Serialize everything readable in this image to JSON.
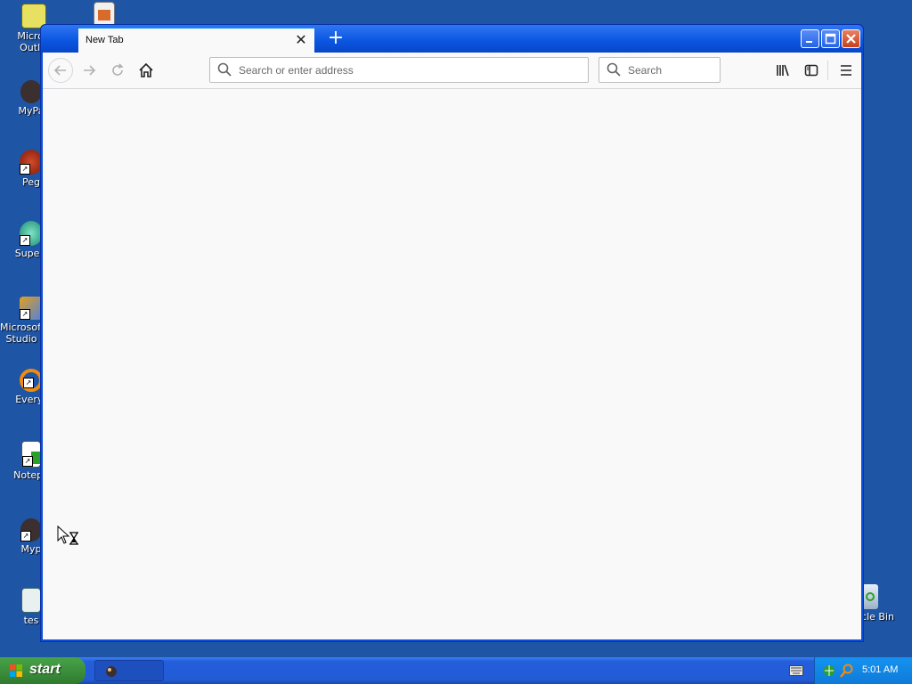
{
  "desktop": {
    "icons": [
      {
        "label": "Micros Outlo",
        "icon": "outlook-icon"
      },
      {
        "label": "MyPa",
        "icon": "people-icon"
      },
      {
        "label": "Peg",
        "icon": "app-icon"
      },
      {
        "label": "Superr",
        "icon": "globe-icon"
      },
      {
        "label": "Microsoft Studio",
        "icon": "studio-icon"
      },
      {
        "label": "Everyt",
        "icon": "search-app-icon"
      },
      {
        "label": "Notepa",
        "icon": "notepad-icon"
      },
      {
        "label": "Myp",
        "icon": "people-icon"
      },
      {
        "label": "tes",
        "icon": "script-icon"
      },
      {
        "label": "cle Bin",
        "icon": "recycle-bin-icon"
      }
    ]
  },
  "browser": {
    "tab_title": "New Tab",
    "url_placeholder": "Search or enter address",
    "search_placeholder": "Search"
  },
  "taskbar": {
    "start_label": "start",
    "clock": "5:01 AM"
  },
  "colors": {
    "desktop": "#1f55a5",
    "titlebar": "#0a55e0",
    "start": "#3c8f3c",
    "tray": "#0f7ad8"
  }
}
